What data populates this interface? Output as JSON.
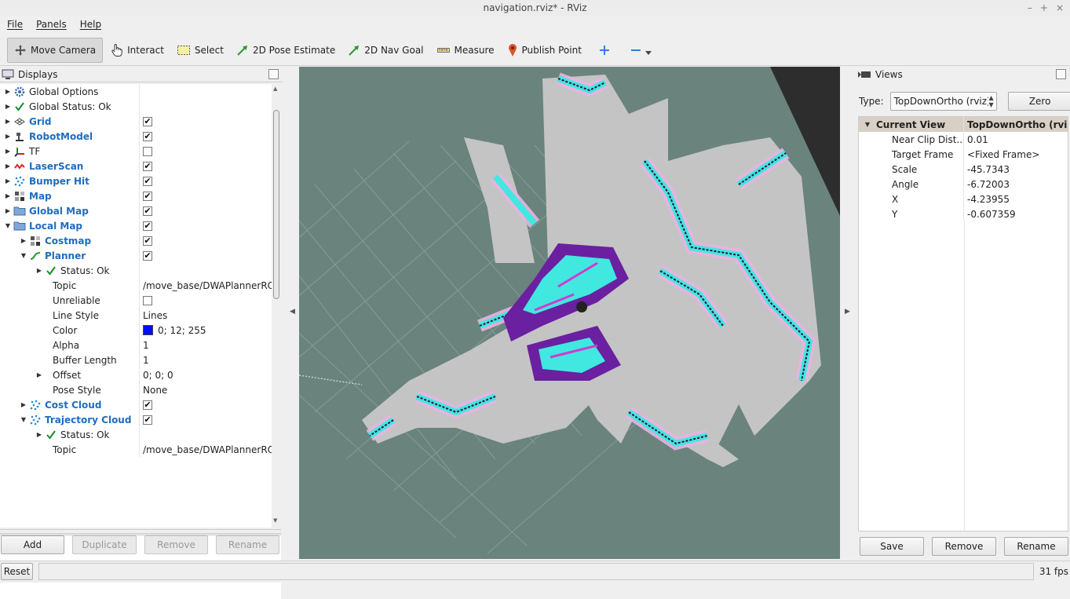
{
  "window": {
    "title": "navigation.rviz* - RViz"
  },
  "menu": [
    "File",
    "Panels",
    "Help"
  ],
  "toolbar": {
    "tools": [
      {
        "label": "Move Camera",
        "icon": "move-camera-icon",
        "active": true
      },
      {
        "label": "Interact",
        "icon": "hand-icon"
      },
      {
        "label": "Select",
        "icon": "select-icon"
      },
      {
        "label": "2D Pose Estimate",
        "icon": "green-arrow-icon"
      },
      {
        "label": "2D Nav Goal",
        "icon": "green-arrow-icon"
      },
      {
        "label": "Measure",
        "icon": "ruler-icon"
      },
      {
        "label": "Publish Point",
        "icon": "map-pin-icon"
      }
    ]
  },
  "displays": {
    "title": "Displays",
    "rows": [
      {
        "indent": 0,
        "arrow": "right",
        "icon": "gear-icon",
        "label": "Global Options",
        "blue": false,
        "value": ""
      },
      {
        "indent": 0,
        "arrow": "right",
        "icon": "check-icon",
        "label": "Global Status: Ok",
        "blue": false,
        "value": ""
      },
      {
        "indent": 0,
        "arrow": "right",
        "icon": "grid-icon",
        "label": "Grid",
        "blue": true,
        "checkbox": true
      },
      {
        "indent": 0,
        "arrow": "right",
        "icon": "robot-icon",
        "label": "RobotModel",
        "blue": true,
        "checkbox": true
      },
      {
        "indent": 0,
        "arrow": "right",
        "icon": "tf-icon",
        "label": "TF",
        "blue": false,
        "checkbox": false
      },
      {
        "indent": 0,
        "arrow": "right",
        "icon": "laserscan-icon",
        "label": "LaserScan",
        "blue": true,
        "checkbox": true
      },
      {
        "indent": 0,
        "arrow": "right",
        "icon": "pointcloud-icon",
        "label": "Bumper Hit",
        "blue": true,
        "checkbox": true
      },
      {
        "indent": 0,
        "arrow": "right",
        "icon": "map-icon",
        "label": "Map",
        "blue": true,
        "checkbox": true
      },
      {
        "indent": 0,
        "arrow": "right",
        "icon": "folder-icon",
        "label": "Global Map",
        "blue": true,
        "checkbox": true
      },
      {
        "indent": 0,
        "arrow": "down",
        "icon": "folder-icon",
        "label": "Local Map",
        "blue": true,
        "checkbox": true
      },
      {
        "indent": 1,
        "arrow": "right",
        "icon": "map-icon",
        "label": "Costmap",
        "blue": true,
        "checkbox": true
      },
      {
        "indent": 1,
        "arrow": "down",
        "icon": "path-icon",
        "label": "Planner",
        "blue": true,
        "checkbox": true
      },
      {
        "indent": 2,
        "arrow": "right",
        "icon": "check-icon",
        "label": "Status: Ok",
        "blue": false,
        "value": ""
      },
      {
        "indent": 2,
        "arrow": "",
        "icon": "",
        "label": "Topic",
        "blue": false,
        "value": "/move_base/DWAPlannerRO..."
      },
      {
        "indent": 2,
        "arrow": "",
        "icon": "",
        "label": "Unreliable",
        "blue": false,
        "checkbox": false
      },
      {
        "indent": 2,
        "arrow": "",
        "icon": "",
        "label": "Line Style",
        "blue": false,
        "value": "Lines"
      },
      {
        "indent": 2,
        "arrow": "",
        "icon": "",
        "label": "Color",
        "blue": false,
        "value": "0; 12; 255",
        "swatch": "#000cff"
      },
      {
        "indent": 2,
        "arrow": "",
        "icon": "",
        "label": "Alpha",
        "blue": false,
        "value": "1"
      },
      {
        "indent": 2,
        "arrow": "",
        "icon": "",
        "label": "Buffer Length",
        "blue": false,
        "value": "1"
      },
      {
        "indent": 2,
        "arrow": "right",
        "icon": "",
        "label": "Offset",
        "blue": false,
        "value": "0; 0; 0"
      },
      {
        "indent": 2,
        "arrow": "",
        "icon": "",
        "label": "Pose Style",
        "blue": false,
        "value": "None"
      },
      {
        "indent": 1,
        "arrow": "right",
        "icon": "pointcloud-icon",
        "label": "Cost Cloud",
        "blue": true,
        "checkbox": true
      },
      {
        "indent": 1,
        "arrow": "down",
        "icon": "pointcloud-icon",
        "label": "Trajectory Cloud",
        "blue": true,
        "checkbox": true
      },
      {
        "indent": 2,
        "arrow": "right",
        "icon": "check-icon",
        "label": "Status: Ok",
        "blue": false,
        "value": ""
      },
      {
        "indent": 2,
        "arrow": "",
        "icon": "",
        "label": "Topic",
        "blue": false,
        "value": "/move_base/DWAPlannerRO..."
      }
    ],
    "buttons": {
      "add": "Add",
      "duplicate": "Duplicate",
      "remove": "Remove",
      "rename": "Rename"
    }
  },
  "views": {
    "title": "Views",
    "type_label": "Type:",
    "type_value": "TopDownOrtho (rviz)",
    "zero": "Zero",
    "header": {
      "name": "Current View",
      "value": "TopDownOrtho (rviz)"
    },
    "props": [
      {
        "label": "Near Clip Dist...",
        "value": "0.01"
      },
      {
        "label": "Target Frame",
        "value": "<Fixed Frame>"
      },
      {
        "label": "Scale",
        "value": "-45.7343"
      },
      {
        "label": "Angle",
        "value": "-6.72003"
      },
      {
        "label": "X",
        "value": "-4.23955"
      },
      {
        "label": "Y",
        "value": "-0.607359"
      }
    ],
    "buttons": {
      "save": "Save",
      "remove": "Remove",
      "rename": "Rename"
    }
  },
  "status": {
    "reset": "Reset",
    "fps": "31 fps"
  },
  "colors": {
    "viewport": "#6a837d",
    "free_space": "#c4c4c4",
    "inflation_cyan": "#40e8e0",
    "inflation_pink": "#e8b4e0",
    "costmap_purple": "#6a20a0",
    "path_blue": "#000cff"
  }
}
